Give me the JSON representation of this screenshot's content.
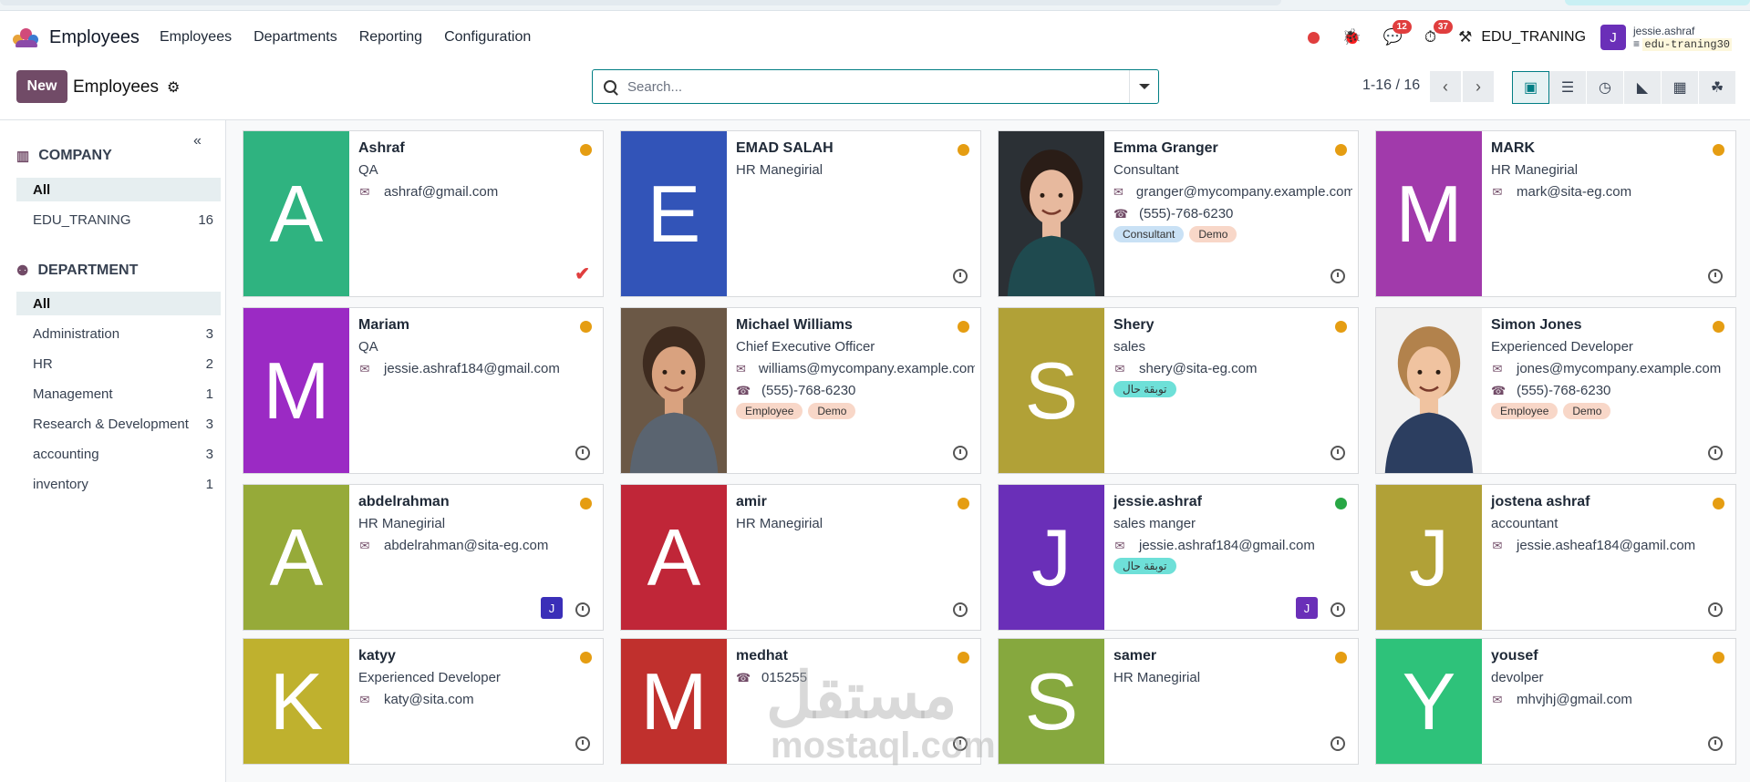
{
  "navbar": {
    "app_title": "Employees",
    "menu": [
      "Employees",
      "Departments",
      "Reporting",
      "Configuration"
    ],
    "chat_badge": "12",
    "activity_badge": "37",
    "company": "EDU_TRANING",
    "user_initial": "J",
    "user_name": "jessie.ashraf",
    "user_db": "edu-traning30"
  },
  "control": {
    "new_label": "New",
    "title": "Employees",
    "search_placeholder": "Search...",
    "pager": "1-16 / 16"
  },
  "sidebar": {
    "company_header": "COMPANY",
    "company_items": [
      {
        "label": "All",
        "count": ""
      },
      {
        "label": "EDU_TRANING",
        "count": "16"
      }
    ],
    "department_header": "DEPARTMENT",
    "department_items": [
      {
        "label": "All",
        "count": ""
      },
      {
        "label": "Administration",
        "count": "3"
      },
      {
        "label": "HR",
        "count": "2"
      },
      {
        "label": "Management",
        "count": "1"
      },
      {
        "label": "Research & Development",
        "count": "3"
      },
      {
        "label": "accounting",
        "count": "3"
      },
      {
        "label": "inventory",
        "count": "1"
      }
    ]
  },
  "employees": [
    {
      "name": "Ashraf",
      "job": "QA",
      "email": "ashraf@gmail.com",
      "phone": "",
      "initial": "A",
      "color": "#2fb380",
      "status": "#e59d12",
      "tags": []
    },
    {
      "name": "EMAD SALAH",
      "job": "HR Manegirial",
      "email": "",
      "phone": "",
      "initial": "E",
      "color": "#3254b8",
      "status": "#e59d12",
      "tags": []
    },
    {
      "name": "Emma Granger",
      "job": "Consultant",
      "email": "granger@mycompany.example.com",
      "phone": "(555)-768-6230",
      "initial": "",
      "color": "#2a2e33",
      "status": "#e59d12",
      "tags": [
        "Consultant",
        "Demo"
      ]
    },
    {
      "name": "MARK",
      "job": "HR Manegirial",
      "email": "mark@sita-eg.com",
      "phone": "",
      "initial": "M",
      "color": "#a13aab",
      "status": "#e59d12",
      "tags": []
    },
    {
      "name": "Mariam",
      "job": "QA",
      "email": "jessie.ashraf184@gmail.com",
      "phone": "",
      "initial": "M",
      "color": "#9b2ac4",
      "status": "#e59d12",
      "tags": []
    },
    {
      "name": "Michael Williams",
      "job": "Chief Executive Officer",
      "email": "williams@mycompany.example.com",
      "phone": "(555)-768-6230",
      "initial": "",
      "color": "#5a4636",
      "status": "#e59d12",
      "tags": [
        "Employee",
        "Demo"
      ]
    },
    {
      "name": "Shery",
      "job": "sales",
      "email": "shery@sita-eg.com",
      "phone": "",
      "initial": "S",
      "color": "#b1a137",
      "status": "#e59d12",
      "tags": [
        "توبقة حال"
      ]
    },
    {
      "name": "Simon Jones",
      "job": "Experienced Developer",
      "email": "jones@mycompany.example.com",
      "phone": "(555)-768-6230",
      "initial": "",
      "color": "#8b7a68",
      "status": "#e59d12",
      "tags": [
        "Employee",
        "Demo"
      ]
    },
    {
      "name": "abdelrahman",
      "job": "HR Manegirial",
      "email": "abdelrahman@sita-eg.com",
      "phone": "",
      "initial": "A",
      "color": "#96aa39",
      "status": "#e59d12",
      "tags": [],
      "mini": "J",
      "mini_color": "#3a2fb8"
    },
    {
      "name": "amir",
      "job": "HR Manegirial",
      "email": "",
      "phone": "",
      "initial": "A",
      "color": "#c02638",
      "status": "#e59d12",
      "tags": []
    },
    {
      "name": "jessie.ashraf",
      "job": "sales manger",
      "email": "jessie.ashraf184@gmail.com",
      "phone": "",
      "initial": "J",
      "color": "#6a2fb8",
      "status": "#28a745",
      "tags": [
        "توبقة حال"
      ],
      "mini": "J",
      "mini_color": "#6a2fb8"
    },
    {
      "name": "jostena ashraf",
      "job": "accountant",
      "email": "jessie.asheaf184@gamil.com",
      "phone": "",
      "initial": "J",
      "color": "#b1a137",
      "status": "#e59d12",
      "tags": []
    },
    {
      "name": "katyy",
      "job": "Experienced Developer",
      "email": "katy@sita.com",
      "phone": "",
      "initial": "K",
      "color": "#bfb12e",
      "status": "#e59d12",
      "tags": []
    },
    {
      "name": "medhat",
      "job": "",
      "email": "",
      "phone": "015255",
      "initial": "M",
      "color": "#c0302d",
      "status": "#e59d12",
      "tags": []
    },
    {
      "name": "samer",
      "job": "HR Manegirial",
      "email": "",
      "phone": "",
      "initial": "S",
      "color": "#86a83e",
      "status": "#e59d12",
      "tags": []
    },
    {
      "name": "yousef",
      "job": "devolper",
      "email": "mhvjhj@gmail.com",
      "phone": "",
      "initial": "Y",
      "color": "#2ec27a",
      "status": "#e59d12",
      "tags": []
    }
  ],
  "watermark": {
    "arabic": "مستقل",
    "latin": "mostaql.com"
  }
}
